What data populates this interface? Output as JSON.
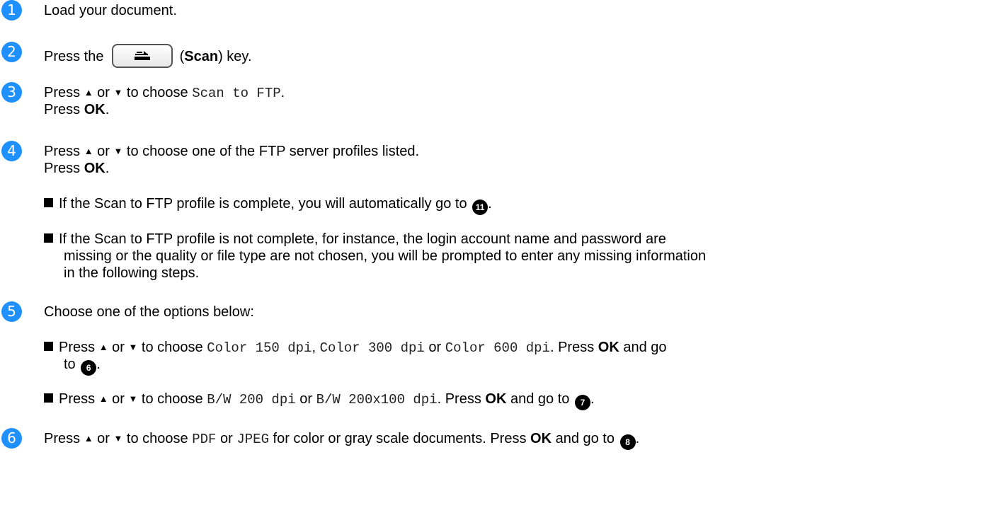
{
  "steps": [
    {
      "num": "1",
      "text": "Load your document."
    },
    {
      "num": "2",
      "pre": "Press the",
      "paren_open": "(",
      "key": "Scan",
      "post": ") key."
    },
    {
      "num": "3",
      "pre": "Press",
      "up": "▲",
      "or": "or",
      "down": "▼",
      "mid": "to choose",
      "code": "Scan to FTP",
      "end": ".",
      "line2_pre": "Press",
      "line2_bold": "OK",
      "line2_end": "."
    },
    {
      "num": "4",
      "pre": "Press",
      "up": "▲",
      "or": "or",
      "down": "▼",
      "mid": "to choose one of the FTP server profiles listed.",
      "line2_pre": "Press",
      "line2_bold": "OK",
      "line2_end": "."
    },
    {
      "num": "5",
      "text": "Choose one of the options below:"
    },
    {
      "num": "6",
      "pre": "Press",
      "up": "▲",
      "or": "or",
      "down": "▼",
      "mid": "to choose",
      "code1": "PDF",
      "or2": "or",
      "code2": "JPEG",
      "post": "for color or gray scale documents. Press",
      "bold": "OK",
      "post2": "and go to",
      "ref": "8",
      "end": "."
    }
  ],
  "step4_bullets": {
    "b1_text": "If the Scan to FTP profile is complete, you will automatically go to",
    "b1_ref": "11",
    "b1_end": ".",
    "b2_line1": "If the Scan to FTP profile is not complete, for instance, the login account name and password are",
    "b2_line2": "missing or the quality or file type are not chosen, you will be prompted to enter any missing information",
    "b2_line3": "in the following steps."
  },
  "step5_bullets": {
    "b1_pre": "Press",
    "b1_up": "▲",
    "b1_or": "or",
    "b1_down": "▼",
    "b1_mid": "to choose",
    "b1_code1": "Color 150 dpi",
    "b1_comma": ",",
    "b1_code2": "Color 300 dpi",
    "b1_or2": "or",
    "b1_code3": "Color 600 dpi",
    "b1_press": ". Press",
    "b1_bold": "OK",
    "b1_goto": "and go",
    "b1_line2": "to",
    "b1_ref": "6",
    "b1_end": ".",
    "b2_pre": "Press",
    "b2_up": "▲",
    "b2_or": "or",
    "b2_down": "▼",
    "b2_mid": "to choose",
    "b2_code1": "B/W 200 dpi",
    "b2_or2": "or",
    "b2_code2": "B/W 200x100 dpi",
    "b2_press": ". Press",
    "b2_bold": "OK",
    "b2_goto": "and go to",
    "b2_ref": "7",
    "b2_end": "."
  },
  "colors": {
    "badge": "#1e90ff"
  },
  "icons": {
    "scan_key": "scan-key-icon"
  }
}
